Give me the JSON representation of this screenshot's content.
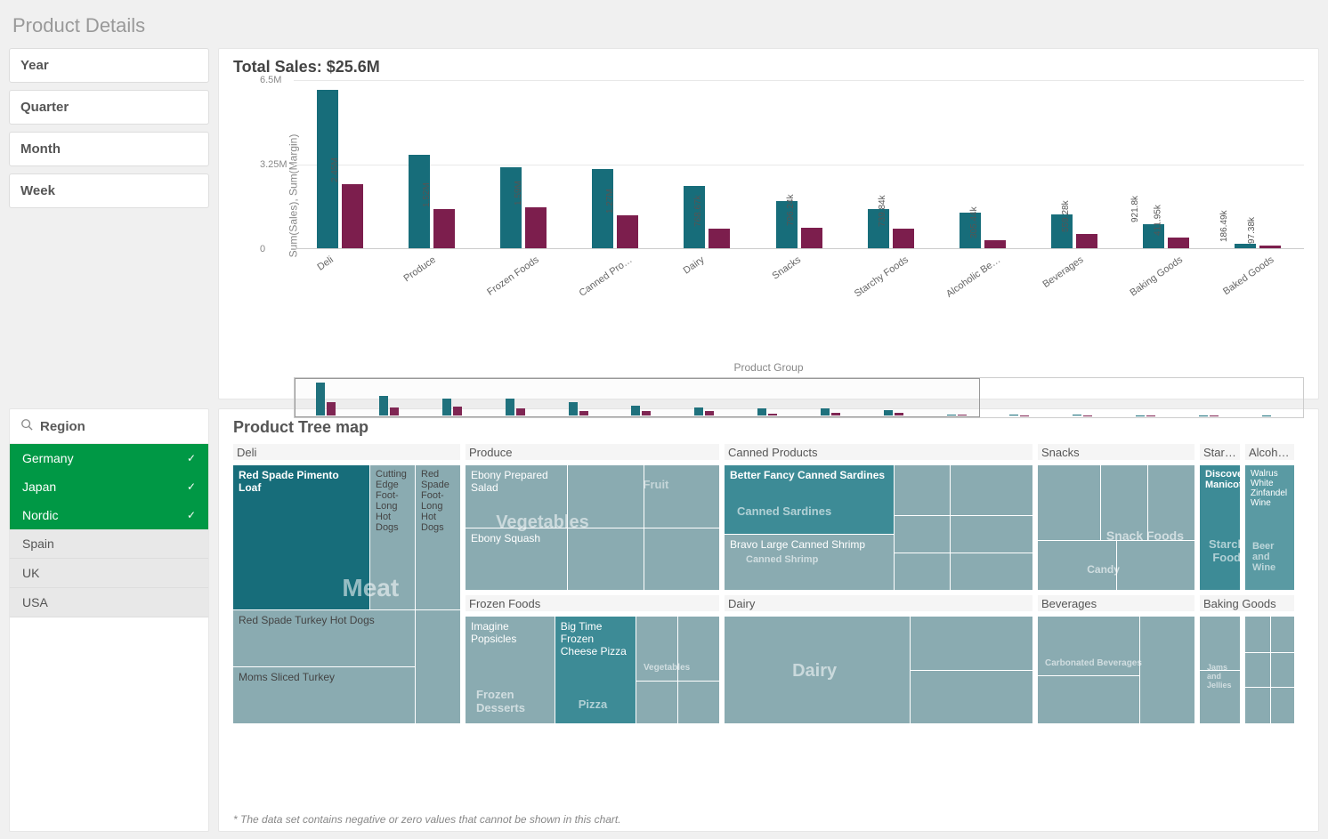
{
  "page_title": "Product Details",
  "filters": {
    "items": [
      "Year",
      "Quarter",
      "Month",
      "Week"
    ]
  },
  "region": {
    "label": "Region",
    "items": [
      {
        "name": "Germany",
        "selected": true
      },
      {
        "name": "Japan",
        "selected": true
      },
      {
        "name": "Nordic",
        "selected": true
      },
      {
        "name": "Spain",
        "selected": false
      },
      {
        "name": "UK",
        "selected": false
      },
      {
        "name": "USA",
        "selected": false
      }
    ]
  },
  "chart": {
    "title": "Total Sales: $25.6M",
    "ylabel": "Sum(Sales), Sum(Margin)",
    "xlabel": "Product Group",
    "yticks": [
      "0",
      "3.25M",
      "6.5M"
    ],
    "footnote": "* The data set contains negative or zero values that cannot be shown in this chart."
  },
  "chart_data": {
    "type": "bar",
    "title": "Total Sales: $25.6M",
    "xlabel": "Product Group",
    "ylabel": "Sum(Sales), Sum(Margin)",
    "ylim": [
      0,
      6500000
    ],
    "categories": [
      "Deli",
      "Produce",
      "Frozen Foods",
      "Canned Pro…",
      "Dairy",
      "Snacks",
      "Starchy Foods",
      "Alcoholic Be…",
      "Beverages",
      "Baking Goods",
      "Baked Goods"
    ],
    "series": [
      {
        "name": "Sum(Sales)",
        "color": "#176d7a",
        "values": [
          6080000,
          3580000,
          3120000,
          3060000,
          2390000,
          1800000,
          1520000,
          1360000,
          1310000,
          921800,
          186490
        ],
        "labels": [
          "6.08M",
          "3.58M",
          "3.12M",
          "3.06M",
          "2.39M",
          "1.8M",
          "1.52M",
          "1.36M",
          "1.31M",
          "921.8k",
          "186.49k"
        ]
      },
      {
        "name": "Sum(Margin)",
        "color": "#7c1e4d",
        "values": [
          2450000,
          1520000,
          1590000,
          1270000,
          768670,
          796240,
          739840,
          305440,
          559280,
          411950,
          97380
        ],
        "labels": [
          "2.45M",
          "1.52M",
          "1.59M",
          "1.27M",
          "768.67k",
          "796.24k",
          "739.84k",
          "305.44k",
          "559.28k",
          "411.95k",
          "97.38k"
        ]
      }
    ],
    "minimap_groups": 16
  },
  "treemap": {
    "title": "Product Tree map",
    "groups": {
      "deli": {
        "header": "Deli",
        "big": "Meat",
        "items": {
          "main": "Red Spade Pimento Loaf",
          "r1": "Cutting Edge Foot-Long Hot Dogs",
          "r2": "Red Spade Foot-Long Hot Dogs",
          "b1": "Red Spade Turkey Hot Dogs",
          "b2": "Moms Sliced Turkey"
        }
      },
      "produce": {
        "header": "Produce",
        "big": "Vegetables",
        "fruit": "Fruit",
        "items": {
          "t": "Ebony Prepared Salad",
          "t2": "Ebony Squash"
        }
      },
      "frozen": {
        "header": "Frozen Foods",
        "items": {
          "l": "Imagine Popsicles",
          "l_sub": "Frozen Desserts",
          "m": "Big Time Frozen Cheese Pizza",
          "m_sub": "Pizza",
          "r_sub": "Vegetables"
        }
      },
      "canned": {
        "header": "Canned Products",
        "items": {
          "t": "Better Fancy Canned Sardines",
          "t_sub": "Canned Sardines",
          "b": "Bravo Large Canned Shrimp",
          "b_sub": "Canned Shrimp"
        }
      },
      "dairy": {
        "header": "Dairy",
        "big": "Dairy"
      },
      "snacks": {
        "header": "Snacks",
        "big": "Snack Foods",
        "sub": "Candy"
      },
      "starchy": {
        "header": "Starchy Fo…",
        "item": "Discover Manicotti",
        "big": "Starchy Foods"
      },
      "alcoholic": {
        "header": "Alcoholic…",
        "item": "Walrus White Zinfandel Wine",
        "big": "Beer and Wine"
      },
      "beverages": {
        "header": "Beverages",
        "big": "Carbonated Beverages"
      },
      "baking": {
        "header": "Baking Goods",
        "big": "Jams and Jellies"
      },
      "baked": {
        "header": ""
      }
    }
  }
}
